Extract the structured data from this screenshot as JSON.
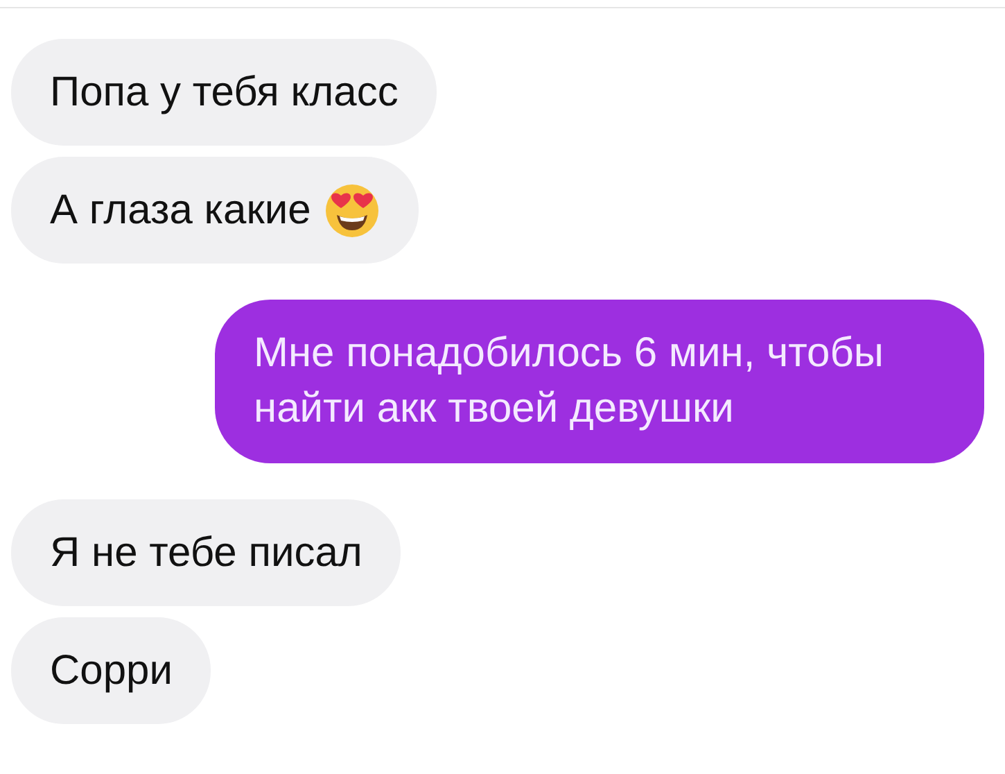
{
  "messages": [
    {
      "kind": "incoming",
      "text": "Попа у тебя класс",
      "emoji": false
    },
    {
      "kind": "incoming",
      "text": "А глаза какие",
      "emoji": true
    },
    {
      "kind": "outgoing",
      "text": "Мне понадобилось 6 мин, чтобы найти акк твоей девушки",
      "emoji": false
    },
    {
      "kind": "incoming",
      "text": "Я не тебе писал",
      "emoji": false
    },
    {
      "kind": "incoming",
      "text": "Сорри",
      "emoji": false
    }
  ]
}
